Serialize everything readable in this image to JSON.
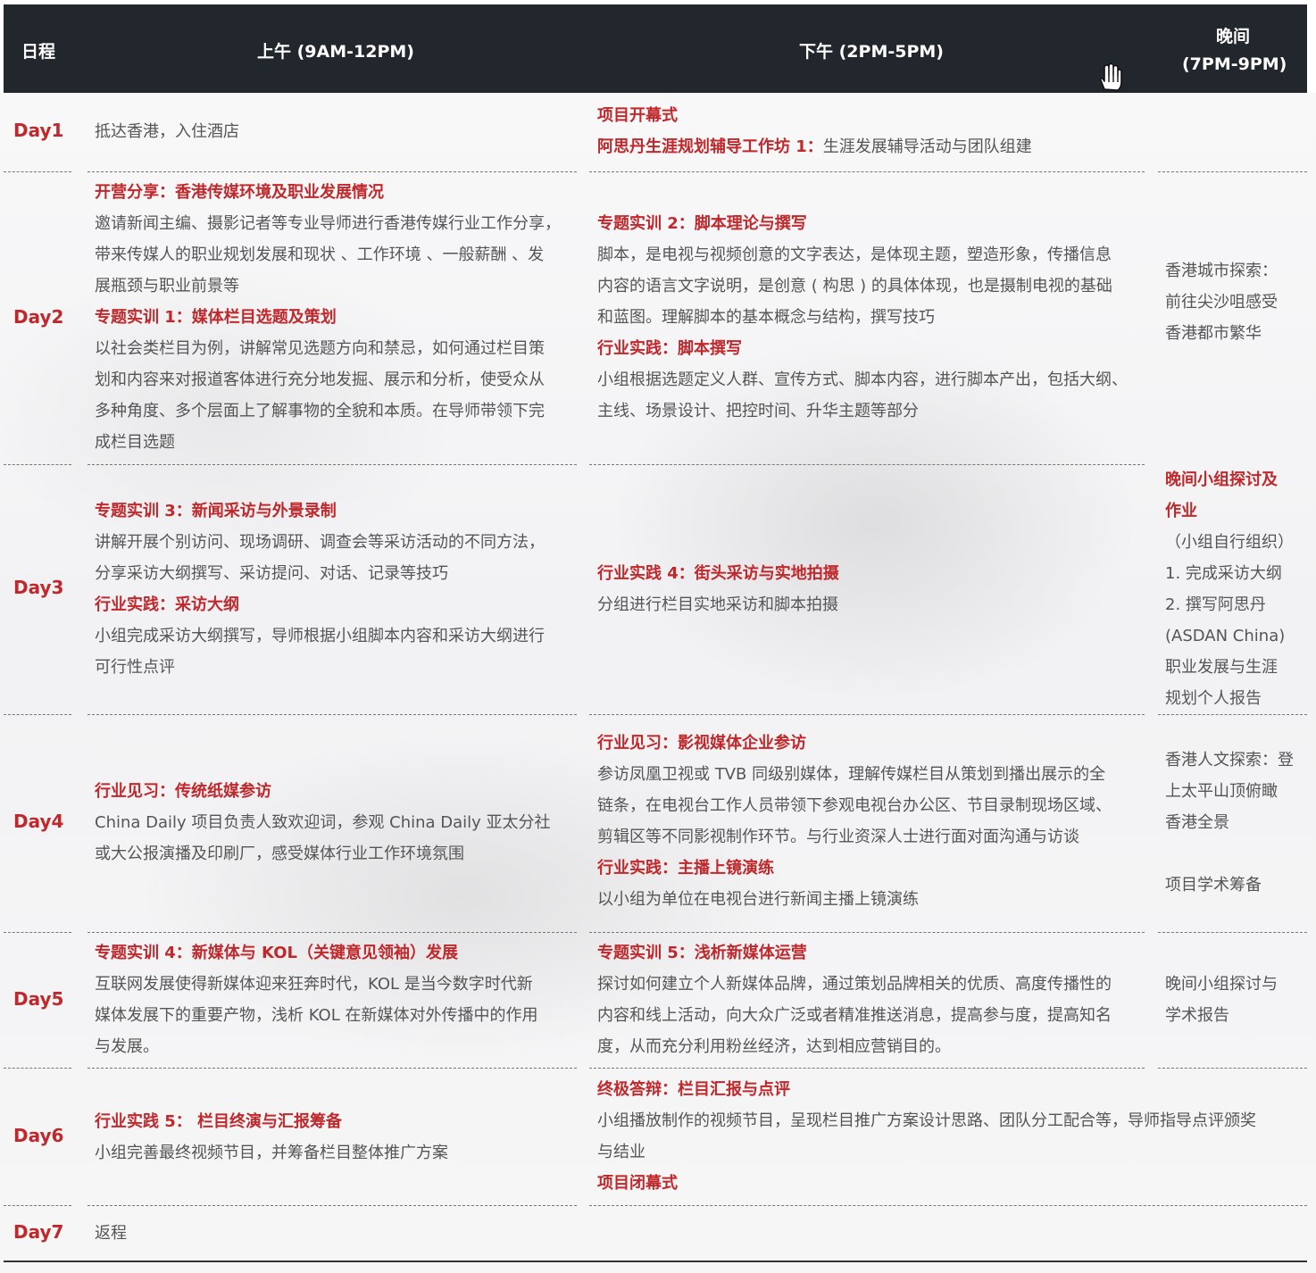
{
  "header": {
    "day": "日程",
    "morning": "上午 (9AM-12PM)",
    "afternoon": "下午 (2PM-5PM)",
    "evening_line1": "晚间",
    "evening_line2": "(7PM-9PM)"
  },
  "days": [
    {
      "label": "Day1",
      "morning": [
        {
          "text": "抵达香港，入住酒店"
        }
      ],
      "afternoon": [
        {
          "text": "项目开幕式",
          "red": true
        },
        {
          "parts": [
            {
              "text": "阿思丹生涯规划辅导工作坊 1：",
              "red": true
            },
            {
              "text": "生涯发展辅导活动与团队组建"
            }
          ]
        }
      ],
      "evening": []
    },
    {
      "label": "Day2",
      "morning": [
        {
          "text": "开营分享：香港传媒环境及职业发展情况",
          "red": true
        },
        {
          "text": "邀请新闻主编、摄影记者等专业导师进行香港传媒行业工作分享，"
        },
        {
          "text": "带来传媒人的职业规划发展和现状 、工作环境 、一般薪酬 、发"
        },
        {
          "text": "展瓶颈与职业前景等"
        },
        {
          "text": "专题实训 1：媒体栏目选题及策划",
          "red": true
        },
        {
          "text": "以社会类栏目为例，讲解常见选题方向和禁忌，如何通过栏目策"
        },
        {
          "text": "划和内容来对报道客体进行充分地发掘、展示和分析，使受众从"
        },
        {
          "text": "多种角度、多个层面上了解事物的全貌和本质。在导师带领下完"
        },
        {
          "text": "成栏目选题"
        }
      ],
      "afternoon": [
        {
          "text": "专题实训 2：脚本理论与撰写",
          "red": true
        },
        {
          "text": "脚本，是电视与视频创意的文字表达，是体现主题，塑造形象，传播信息"
        },
        {
          "text": "内容的语言文字说明，是创意 ( 构思 ) 的具体体现，也是摄制电视的基础"
        },
        {
          "text": "和蓝图。理解脚本的基本概念与结构，撰写技巧"
        },
        {
          "text": "行业实践：脚本撰写",
          "red": true
        },
        {
          "text": "小组根据选题定义人群、宣传方式、脚本内容，进行脚本产出，包括大纲、"
        },
        {
          "text": "主线、场景设计、把控时间、升华主题等部分"
        }
      ],
      "evening": [
        {
          "text": "香港城市探索："
        },
        {
          "text": "前往尖沙咀感受"
        },
        {
          "text": "香港都市繁华"
        }
      ]
    },
    {
      "label": "Day3",
      "morning": [
        {
          "text": "专题实训 3：新闻采访与外景录制",
          "red": true
        },
        {
          "text": "讲解开展个别访问、现场调研、调查会等采访活动的不同方法，"
        },
        {
          "text": "分享采访大纲撰写、采访提问、对话、记录等技巧"
        },
        {
          "text": "行业实践：采访大纲",
          "red": true
        },
        {
          "text": "小组完成采访大纲撰写，导师根据小组脚本内容和采访大纲进行"
        },
        {
          "text": "可行性点评"
        }
      ],
      "afternoon": [
        {
          "text": "行业实践 4：街头采访与实地拍摄",
          "red": true
        },
        {
          "text": "分组进行栏目实地采访和脚本拍摄"
        }
      ],
      "evening": [
        {
          "text": "晚间小组探讨及",
          "red": true
        },
        {
          "text": "作业",
          "red": true
        },
        {
          "text": "（小组自行组织）"
        },
        {
          "text": "1. 完成采访大纲"
        },
        {
          "text": "2. 撰写阿思丹"
        },
        {
          "text": "(ASDAN China)"
        },
        {
          "text": "职业发展与生涯"
        },
        {
          "text": "规划个人报告"
        }
      ]
    },
    {
      "label": "Day4",
      "morning": [
        {
          "text": "行业见习：传统纸媒参访",
          "red": true
        },
        {
          "text": "China Daily 项目负责人致欢迎词，参观 China Daily 亚太分社"
        },
        {
          "text": "或大公报演播及印刷厂，感受媒体行业工作环境氛围"
        }
      ],
      "afternoon": [
        {
          "text": "行业见习：影视媒体企业参访",
          "red": true
        },
        {
          "text": "参访凤凰卫视或 TVB 同级别媒体，理解传媒栏目从策划到播出展示的全"
        },
        {
          "text": "链条，在电视台工作人员带领下参观电视台办公区、节目录制现场区域、"
        },
        {
          "text": "剪辑区等不同影视制作环节。与行业资深人士进行面对面沟通与访谈"
        },
        {
          "text": "行业实践：主播上镜演练",
          "red": true
        },
        {
          "text": "以小组为单位在电视台进行新闻主播上镜演练"
        }
      ],
      "evening": [
        {
          "text": "香港人文探索：登"
        },
        {
          "text": "上太平山顶俯瞰"
        },
        {
          "text": "香港全景"
        },
        {
          "text": ""
        },
        {
          "text": "项目学术筹备"
        }
      ]
    },
    {
      "label": "Day5",
      "morning": [
        {
          "text": "专题实训 4：新媒体与 KOL（关键意见领袖）发展",
          "red": true
        },
        {
          "text": "互联网发展使得新媒体迎来狂奔时代，KOL 是当今数字时代新"
        },
        {
          "text": "媒体发展下的重要产物，浅析 KOL 在新媒体对外传播中的作用"
        },
        {
          "text": "与发展。"
        }
      ],
      "afternoon": [
        {
          "text": "专题实训 5：浅析新媒体运营",
          "red": true
        },
        {
          "text": "探讨如何建立个人新媒体品牌，通过策划品牌相关的优质、高度传播性的"
        },
        {
          "text": "内容和线上活动，向大众广泛或者精准推送消息，提高参与度，提高知名"
        },
        {
          "text": "度，从而充分利用粉丝经济，达到相应营销目的。"
        }
      ],
      "evening": [
        {
          "text": "晚间小组探讨与"
        },
        {
          "text": "学术报告"
        }
      ]
    },
    {
      "label": "Day6",
      "morning": [
        {
          "text": "行业实践 5： 栏目终演与汇报筹备",
          "red": true
        },
        {
          "text": "小组完善最终视频节目，并筹备栏目整体推广方案"
        }
      ],
      "afternoon": [
        {
          "text": "终极答辩：栏目汇报与点评",
          "red": true
        },
        {
          "text": "小组播放制作的视频节目，呈现栏目推广方案设计思路、团队分工配合等，导师指导点评颁奖"
        },
        {
          "text": "与结业"
        },
        {
          "text": "项目闭幕式",
          "red": true
        }
      ],
      "evening": []
    },
    {
      "label": "Day7",
      "morning": [
        {
          "text": "返程"
        }
      ],
      "afternoon": [],
      "evening": []
    }
  ]
}
